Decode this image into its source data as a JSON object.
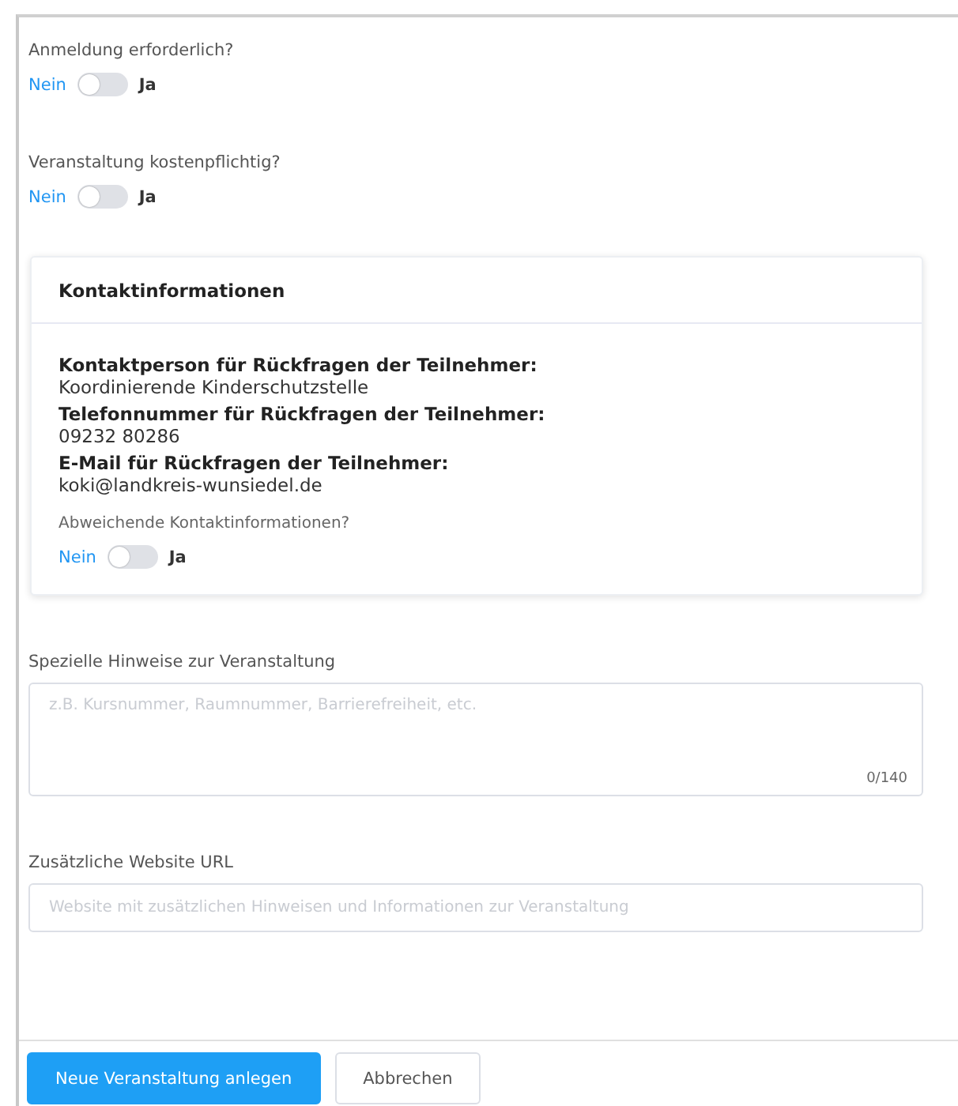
{
  "questions": [
    {
      "label": "Anmeldung erforderlich?",
      "off_label": "Nein",
      "on_label": "Ja",
      "on": false
    },
    {
      "label": "Veranstaltung kostenpflichtig?",
      "off_label": "Nein",
      "on_label": "Ja",
      "on": false
    }
  ],
  "contact_card": {
    "title": "Kontaktinformationen",
    "entries": [
      {
        "label": "Kontaktperson für Rückfragen der Teilnehmer:",
        "value": "Koordinierende Kinderschutzstelle"
      },
      {
        "label": "Telefonnummer für Rückfragen der Teilnehmer:",
        "value": "09232 80286"
      },
      {
        "label": "E-Mail für Rückfragen der Teilnehmer:",
        "value": "koki@landkreis-wunsiedel.de"
      }
    ],
    "question": {
      "label": "Abweichende Kontaktinformationen?",
      "off_label": "Nein",
      "on_label": "Ja",
      "on": false
    }
  },
  "notes": {
    "label": "Spezielle Hinweise zur Veranstaltung",
    "placeholder": "z.B. Kursnummer, Raumnummer, Barrierefreiheit, etc.",
    "counter": "0/140"
  },
  "website": {
    "label": "Zusätzliche Website URL",
    "placeholder": "Website mit zusätzlichen Hinweisen und Informationen zur Veranstaltung"
  },
  "buttons": [
    {
      "label": "Neue Veranstaltung anlegen",
      "kind": "primary"
    },
    {
      "label": "Abbrechen",
      "kind": "secondary"
    }
  ]
}
